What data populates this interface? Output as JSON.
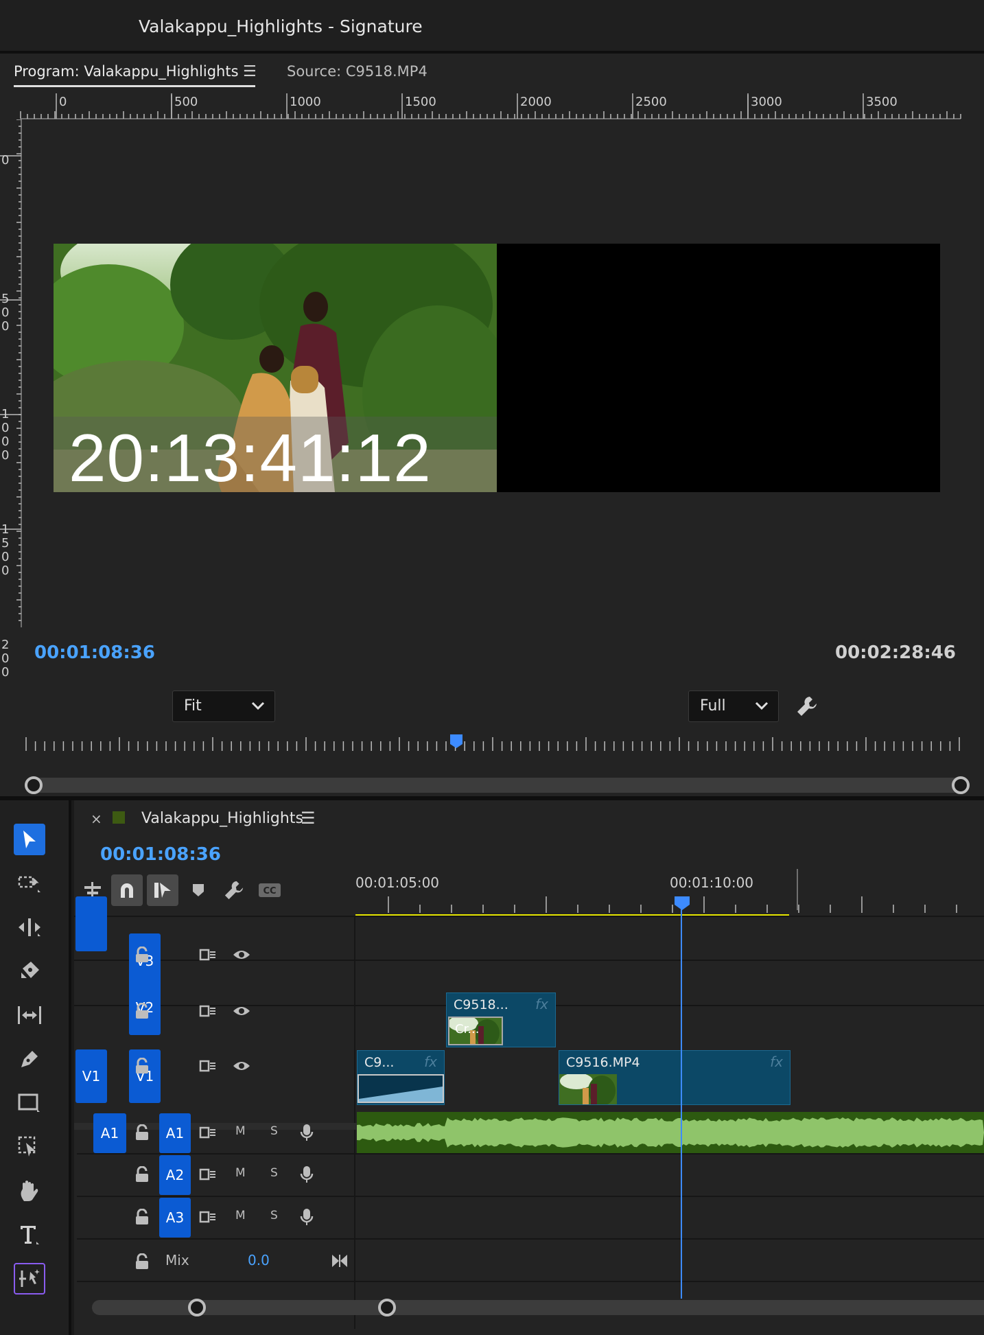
{
  "window": {
    "title": "Valakappu_Highlights - Signature"
  },
  "program_panel": {
    "tab_program": "Program: Valakappu_Highlights",
    "tab_source": "Source: C9518.MP4",
    "ruler_h_labels": [
      "0",
      "500",
      "1000",
      "1500",
      "2000",
      "2500",
      "3000",
      "3500"
    ],
    "ruler_v_labels": [
      "0",
      "5\n0\n0",
      "1\n0\n0\n0",
      "1\n5\n0\n0",
      "2\n0\n0"
    ],
    "overlay_timecode": "20:13:41:12",
    "current_timecode": "00:01:08:36",
    "zoom_select": "Fit",
    "resolution_select": "Full",
    "duration_timecode": "00:02:28:46"
  },
  "timeline": {
    "sequence_name": "Valakappu_Highlights",
    "sequence_color": "#3d5a12",
    "current_timecode": "00:01:08:36",
    "ruler_labels": [
      "00:01:05:00",
      "00:01:10:00"
    ],
    "video_tracks": [
      {
        "id": "V3",
        "source_patch": ""
      },
      {
        "id": "V2",
        "source_patch": ""
      },
      {
        "id": "V1",
        "source_patch": "V1"
      }
    ],
    "audio_tracks": [
      {
        "id": "A1",
        "source_patch": "A1"
      },
      {
        "id": "A2",
        "source_patch": ""
      },
      {
        "id": "A3",
        "source_patch": ""
      }
    ],
    "track_mute_label": "M",
    "track_solo_label": "S",
    "mix_label": "Mix",
    "mix_value": "0.0",
    "clips": [
      {
        "name": "C9518...",
        "track": "V2",
        "sublabel": "Cr...",
        "fx": "fx"
      },
      {
        "name": "C9...",
        "track": "V1",
        "fx": "fx"
      },
      {
        "name": "C9516.MP4",
        "track": "V1",
        "fx": "fx"
      }
    ]
  },
  "colors": {
    "accent_blue": "#4aa3ff",
    "track_blue": "#0b5bd3",
    "clip_teal": "#0c4866",
    "audio_green": "#8fc46a",
    "work_area_yellow": "#e6e600"
  }
}
